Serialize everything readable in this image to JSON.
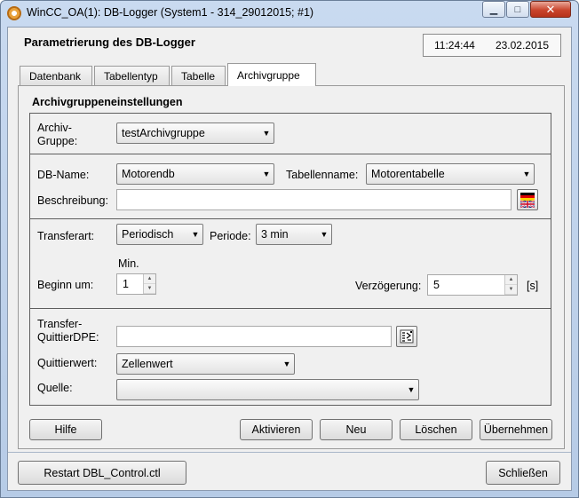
{
  "window": {
    "title": "WinCC_OA(1): DB-Logger (System1 - 314_29012015; #1)",
    "minimize": "▁",
    "maximize": "□",
    "close": "✕"
  },
  "header": {
    "title": "Parametrierung des DB-Logger",
    "time": "11:24:44",
    "date": "23.02.2015"
  },
  "tabs": [
    {
      "label": "Datenbank"
    },
    {
      "label": "Tabellentyp"
    },
    {
      "label": "Tabelle"
    },
    {
      "label": "Archivgruppe"
    }
  ],
  "active_tab": "Archivgruppe",
  "section": {
    "title": "Archivgruppeneinstellungen"
  },
  "group1": {
    "archiv_label": "Archiv-\nGruppe:",
    "archiv_value": "testArchivgruppe"
  },
  "group2": {
    "dbname_label": "DB-Name:",
    "dbname_value": "Motorendb",
    "tabellenname_label": "Tabellenname:",
    "tabellenname_value": "Motorentabelle",
    "beschreibung_label": "Beschreibung:",
    "beschreibung_value": ""
  },
  "group3": {
    "transferart_label": "Transferart:",
    "transferart_value": "Periodisch",
    "periode_label": "Periode:",
    "periode_value": "3 min",
    "min_label": "Min.",
    "beginn_label": "Beginn um:",
    "beginn_value": "1",
    "verzoegerung_label": "Verzögerung:",
    "verzoegerung_value": "5",
    "unit_label": "[s]"
  },
  "group4": {
    "transfer_label": "Transfer-\nQuittierDPE:",
    "transfer_value": "",
    "quittierwert_label": "Quittierwert:",
    "quittierwert_value": "Zellenwert",
    "quelle_label": "Quelle:",
    "quelle_value": ""
  },
  "actions": {
    "hilfe": "Hilfe",
    "aktivieren": "Aktivieren",
    "neu": "Neu",
    "loeschen": "Löschen",
    "uebernehmen": "Übernehmen"
  },
  "footer": {
    "restart": "Restart DBL_Control.ctl",
    "schliessen": "Schließen"
  },
  "icons": {
    "language": "flag-icon",
    "dpe_select": "dp-selector-icon",
    "dropdown": "chevron-down-icon"
  },
  "colors": {
    "window_frame": "#c9daf0",
    "client_bg": "#f0f0f0",
    "close_button": "#c9452d"
  }
}
